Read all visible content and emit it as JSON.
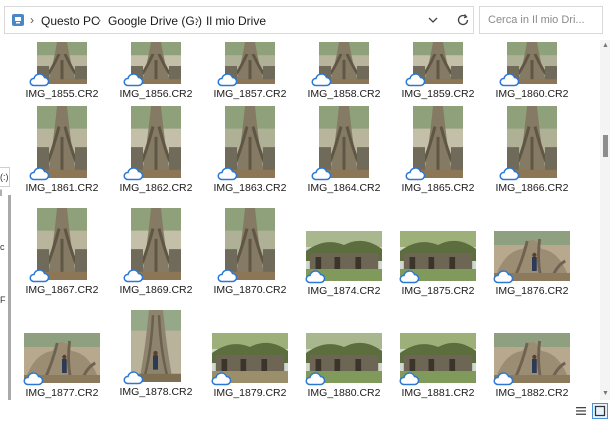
{
  "address": {
    "crumbs": [
      "Questo PC",
      "Google Drive (G:)",
      "Il mio Drive"
    ],
    "search_placeholder": "Cerca in Il mio Dri..."
  },
  "navpane": {
    "tab_text": "(:)",
    "glyphs": [
      "l",
      "c",
      "F"
    ]
  },
  "files": [
    {
      "name": "IMG_1855.CR2",
      "thumb": "tree-vertical"
    },
    {
      "name": "IMG_1856.CR2",
      "thumb": "tree-vertical"
    },
    {
      "name": "IMG_1857.CR2",
      "thumb": "tree-vertical"
    },
    {
      "name": "IMG_1858.CR2",
      "thumb": "tree-vertical"
    },
    {
      "name": "IMG_1859.CR2",
      "thumb": "tree-vertical"
    },
    {
      "name": "IMG_1860.CR2",
      "thumb": "tree-vertical"
    },
    {
      "name": "IMG_1861.CR2",
      "thumb": "tree-vertical"
    },
    {
      "name": "IMG_1862.CR2",
      "thumb": "tree-vertical"
    },
    {
      "name": "IMG_1863.CR2",
      "thumb": "tree-vertical"
    },
    {
      "name": "IMG_1864.CR2",
      "thumb": "tree-vertical"
    },
    {
      "name": "IMG_1865.CR2",
      "thumb": "tree-vertical"
    },
    {
      "name": "IMG_1866.CR2",
      "thumb": "tree-vertical"
    },
    {
      "name": "IMG_1867.CR2",
      "thumb": "tree-vertical"
    },
    {
      "name": "IMG_1869.CR2",
      "thumb": "tree-vertical"
    },
    {
      "name": "IMG_1870.CR2",
      "thumb": "tree-vertical"
    },
    {
      "name": "IMG_1874.CR2",
      "thumb": "temple-horizontal"
    },
    {
      "name": "IMG_1875.CR2",
      "thumb": "temple-horizontal"
    },
    {
      "name": "IMG_1876.CR2",
      "thumb": "roots-person"
    },
    {
      "name": "IMG_1877.CR2",
      "thumb": "roots-person"
    },
    {
      "name": "IMG_1878.CR2",
      "thumb": "tree-person-vertical"
    },
    {
      "name": "IMG_1879.CR2",
      "thumb": "temple-horizontal"
    },
    {
      "name": "IMG_1880.CR2",
      "thumb": "temple-horizontal"
    },
    {
      "name": "IMG_1881.CR2",
      "thumb": "temple-horizontal"
    },
    {
      "name": "IMG_1882.CR2",
      "thumb": "roots-person"
    }
  ],
  "colors": {
    "cloud_outline": "#2b78d4",
    "accent": "#0078d4"
  },
  "icons": {
    "pc": "pc-icon",
    "separator": "chevron-right-icon",
    "dropdown": "chevron-down-icon",
    "refresh": "refresh-icon",
    "cloud_status": "cloud-icon",
    "view_details": "details-view-icon",
    "view_thumbs": "large-icons-view-icon"
  }
}
